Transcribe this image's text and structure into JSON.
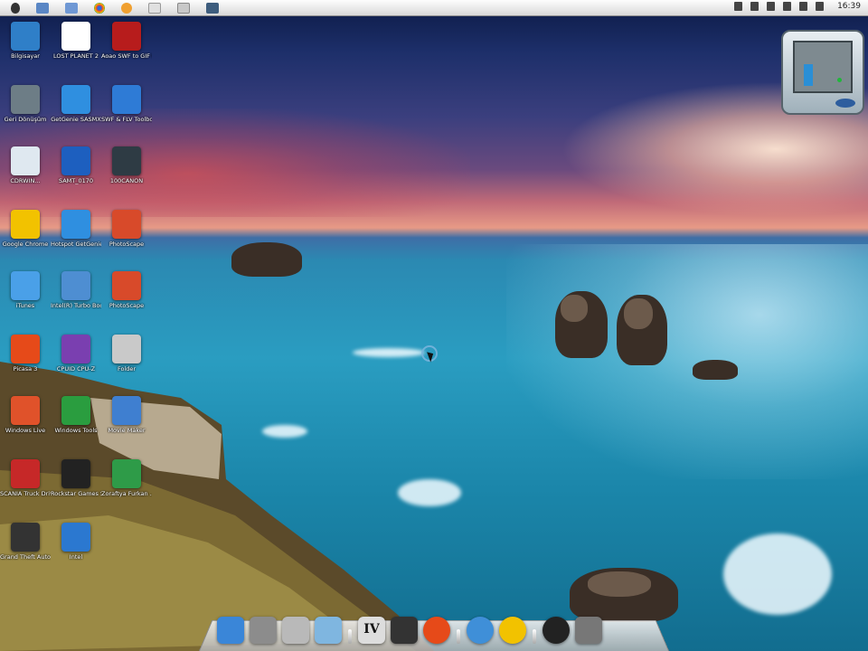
{
  "menubar": {
    "icons": [
      "apple-icon",
      "tool-icon",
      "folder-icon",
      "chrome-icon",
      "app-icon",
      "script-icon",
      "window-icon",
      "monitor-icon"
    ],
    "tray": [
      "network-icon",
      "usb-icon",
      "volume-mute-icon",
      "flag-icon",
      "wifi-icon",
      "speaker-icon"
    ],
    "clock": "16:39"
  },
  "desktop_icons": [
    {
      "label": "Bilgisayar",
      "icon": "computer-icon",
      "color": "#2f7fc8"
    },
    {
      "label": "LOST PLANET 2",
      "icon": "document-icon",
      "color": "#ffffff"
    },
    {
      "label": "Aoao SWF to GIF Converter",
      "icon": "flash-icon",
      "color": "#b71c1c"
    },
    {
      "label": "Geri Dönüşüm",
      "icon": "recycle-bin-icon",
      "color": "#6d7d86"
    },
    {
      "label": "GetGenie SASMX",
      "icon": "cube-icon",
      "color": "#2f8fe0"
    },
    {
      "label": "SWF & FLV Toolbox",
      "icon": "box-icon",
      "color": "#2e7bd6"
    },
    {
      "label": "CDRWIN...",
      "icon": "disc-icon",
      "color": "#dfe8f0"
    },
    {
      "label": "SAMT_0170",
      "icon": "video-icon",
      "color": "#1d5fbf"
    },
    {
      "label": "100CANON",
      "icon": "folder-dark-icon",
      "color": "#2e3b44"
    },
    {
      "label": "Google Chrome",
      "icon": "chrome-icon",
      "color": "#f2c200"
    },
    {
      "label": "Hotspot GetGenie",
      "icon": "cube-icon",
      "color": "#2f8fe0"
    },
    {
      "label": "PhotoScape",
      "icon": "photoscape-icon",
      "color": "#d84a2a"
    },
    {
      "label": "iTunes",
      "icon": "itunes-icon",
      "color": "#4aa0e8"
    },
    {
      "label": "Intel(R) Turbo Boost Tech",
      "icon": "monitor-icon",
      "color": "#4e8ed2"
    },
    {
      "label": "PhotoScape",
      "icon": "photoscape-icon",
      "color": "#d84a2a"
    },
    {
      "label": "Picasa 3",
      "icon": "picasa-icon",
      "color": "#e64a19"
    },
    {
      "label": "CPUID CPU-Z",
      "icon": "cpuz-icon",
      "color": "#7a3fb0"
    },
    {
      "label": "Folder",
      "icon": "file-icon",
      "color": "#c9c9c9"
    },
    {
      "label": "Windows Live",
      "icon": "photo-gallery-icon",
      "color": "#e0522a"
    },
    {
      "label": "Windows Tools",
      "icon": "tools-icon",
      "color": "#2a9d3f"
    },
    {
      "label": "Movie Maker",
      "icon": "movie-maker-icon",
      "color": "#3f7fd0"
    },
    {
      "label": "SCANIA Truck Driving Sim",
      "icon": "truck-icon",
      "color": "#c62828"
    },
    {
      "label": "Rockstar Games Soci...",
      "icon": "rockstar-icon",
      "color": "#222222"
    },
    {
      "label": "Zoraftya Furkan ...",
      "icon": "excel-icon",
      "color": "#2e9b48"
    },
    {
      "label": "Grand Theft Auto IV",
      "icon": "gta-icon",
      "color": "#333333"
    },
    {
      "label": "Intel",
      "icon": "ie-icon",
      "color": "#2b78d0"
    }
  ],
  "dock": [
    {
      "name": "finder-icon",
      "color": "#3a86d8"
    },
    {
      "name": "system-preferences-icon",
      "color": "#8c8c8c"
    },
    {
      "name": "disk-utility-icon",
      "color": "#b9b9b9"
    },
    {
      "name": "documents-folder-icon",
      "color": "#7fb6e0"
    },
    {
      "sep": true
    },
    {
      "name": "gta-iv-icon",
      "color": "#dddddd"
    },
    {
      "name": "film-icon",
      "color": "#333333"
    },
    {
      "name": "picasa-icon",
      "color": "#e64a19"
    },
    {
      "sep": true
    },
    {
      "name": "itunes-icon",
      "color": "#3f8fd8"
    },
    {
      "name": "chrome-icon",
      "color": "#f2c200"
    },
    {
      "sep": true
    },
    {
      "name": "dashboard-icon",
      "color": "#222222"
    },
    {
      "name": "trash-icon",
      "color": "#777777"
    }
  ],
  "dock_labels": {
    "gta": "IV"
  },
  "gadget": {
    "name": "cpu-meter-gadget",
    "bar_color": "#2a8fd6",
    "led_color": "#21b63b"
  }
}
